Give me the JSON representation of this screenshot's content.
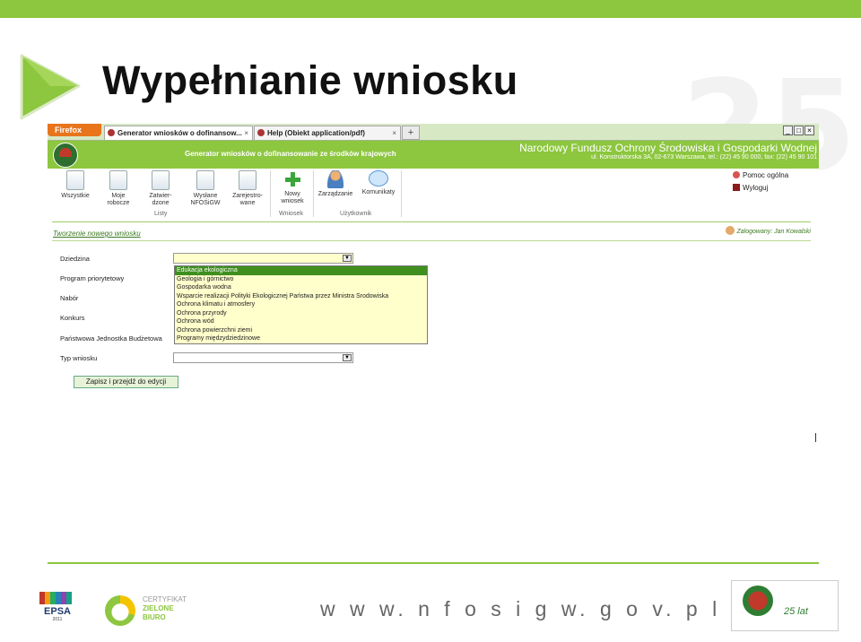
{
  "slide": {
    "title": "Wypełnianie wniosku",
    "url": "w w w. n f o s i g w. g o v. p l"
  },
  "browser": {
    "firefox_label": "Firefox",
    "tabs": [
      {
        "label": "Generator wniosków o dofinansow...",
        "close": "×"
      },
      {
        "label": "Help (Obiekt application/pdf)",
        "close": "×"
      }
    ],
    "new_tab": "+",
    "window_buttons": [
      "_",
      "□",
      "×"
    ]
  },
  "app": {
    "header_title": "Generator wniosków o dofinansowanie ze środków krajowych",
    "org_name": "Narodowy Fundusz Ochrony Środowiska i Gospodarki Wodnej",
    "org_address": "ul. Konstruktorska 3A, 02-673 Warszawa, tel.: (22) 45 90 000, fax: (22) 45 90 101"
  },
  "ribbon": {
    "buttons": [
      {
        "line1": "Wszystkie",
        "line2": ""
      },
      {
        "line1": "Moje",
        "line2": "robocze"
      },
      {
        "line1": "Zatwier-",
        "line2": "dzone"
      },
      {
        "line1": "Wysłane",
        "line2": "NFOŚiGW"
      },
      {
        "line1": "Zarejestro-",
        "line2": "wane"
      },
      {
        "line1": "Nowy",
        "line2": "wniosek"
      },
      {
        "line1": "Zarządzanie",
        "line2": ""
      },
      {
        "line1": "Komunikaty",
        "line2": ""
      }
    ],
    "groups": {
      "listy": "Listy",
      "wniosek": "Wniosek",
      "uzytkownik": "Użytkownik"
    },
    "help": "Pomoc ogólna",
    "logout": "Wyloguj"
  },
  "form": {
    "title": "Tworzenie nowego wniosku",
    "logged_in": "Zalogowany: Jan Kowalski",
    "labels": {
      "dziedzina": "Dziedzina",
      "program": "Program priorytetowy",
      "nabor": "Nabór",
      "konkurs": "Konkurs",
      "pjb": "Państwowa Jednostka Budżetowa",
      "typ": "Typ wniosku"
    },
    "dropdown_arrow": "▼",
    "options": [
      "Edukacja ekologiczna",
      "Geologia i górnictwo",
      "Gospodarka wodna",
      "Wsparcie realizacji Polityki Ekologicznej Państwa przez Ministra Środowiska",
      "Ochrona klimatu i atmosfery",
      "Ochrona przyrody",
      "Ochrona wód",
      "Ochrona powierzchni ziemi",
      "Programy międzydziedzinowe"
    ],
    "selected_index": 0,
    "save_button": "Zapisz i przejdź do edycji"
  },
  "footer": {
    "epsa": "EPSA",
    "epsa_year": "2011",
    "green_office_1": "CERTYFIKAT",
    "green_office_2": "ZIELONE",
    "green_office_3": "BIURO",
    "fund_years": "25 lat"
  },
  "colors": {
    "brand_green": "#8dc63f",
    "selection_green": "#3f8f1f",
    "field_yellow": "#ffffcc"
  }
}
